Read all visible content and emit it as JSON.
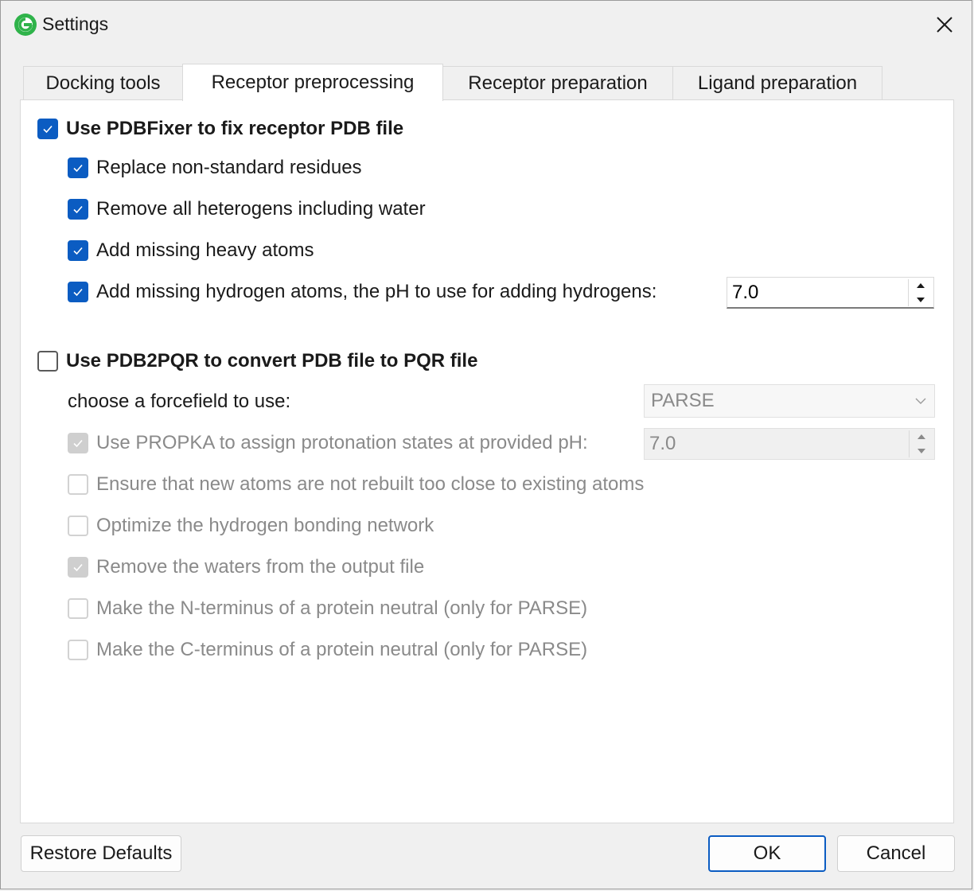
{
  "window": {
    "title": "Settings"
  },
  "tabs": [
    {
      "label": "Docking tools",
      "active": false
    },
    {
      "label": "Receptor preprocessing",
      "active": true
    },
    {
      "label": "Receptor preparation",
      "active": false
    },
    {
      "label": "Ligand preparation",
      "active": false
    }
  ],
  "pdbfixer": {
    "label": "Use PDBFixer to fix receptor PDB file",
    "checked": true,
    "options": [
      {
        "label": "Replace non-standard residues",
        "checked": true
      },
      {
        "label": "Remove all heterogens including water",
        "checked": true
      },
      {
        "label": "Add missing heavy atoms",
        "checked": true
      },
      {
        "label": "Add missing hydrogen atoms, the pH to use for adding hydrogens:",
        "checked": true
      }
    ],
    "ph_value": "7.0"
  },
  "pdb2pqr": {
    "label": "Use PDB2PQR to convert PDB file to PQR file",
    "checked": false,
    "forcefield_label": "choose a forcefield to use:",
    "forcefield_value": "PARSE",
    "propka": {
      "label": "Use PROPKA to assign protonation states at provided pH:",
      "checked": true,
      "value": "7.0"
    },
    "options": [
      {
        "label": "Ensure that new atoms are not rebuilt too close to existing atoms",
        "checked": false
      },
      {
        "label": "Optimize the hydrogen bonding network",
        "checked": false
      },
      {
        "label": "Remove the waters from the output file",
        "checked": true
      },
      {
        "label": "Make the N-terminus of a protein neutral (only for PARSE)",
        "checked": false
      },
      {
        "label": "Make the C-terminus of a protein neutral (only for PARSE)",
        "checked": false
      }
    ]
  },
  "buttons": {
    "restore": "Restore Defaults",
    "ok": "OK",
    "cancel": "Cancel"
  },
  "colors": {
    "accent": "#0b5cc2",
    "app_icon": "#2fb34a"
  },
  "icons": {
    "app": "app-logo-icon",
    "close": "close-icon",
    "check": "checkmark-icon",
    "spin_up": "spin-up-icon",
    "spin_down": "spin-down-icon",
    "dropdown": "chevron-down-icon"
  }
}
